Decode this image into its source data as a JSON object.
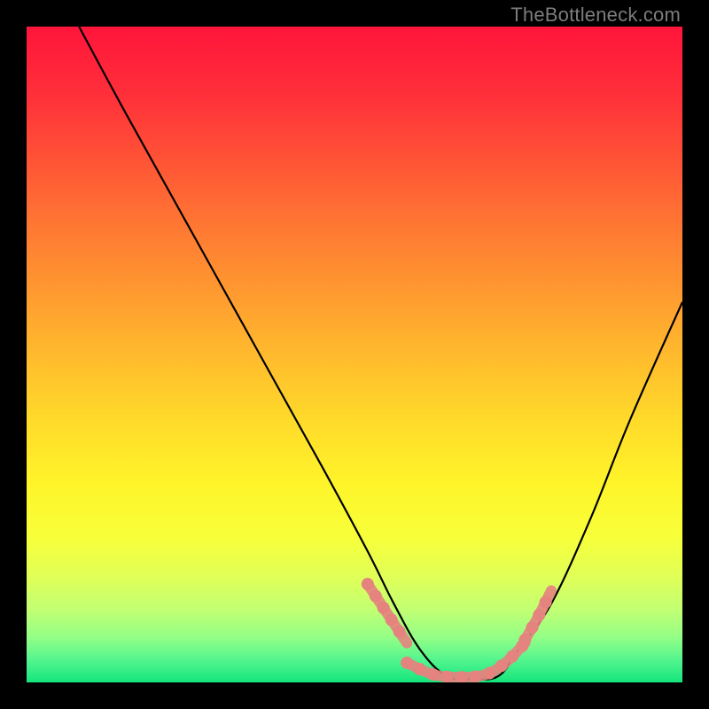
{
  "watermark": "TheBottleneck.com",
  "gradient": {
    "stops": [
      {
        "offset": 0.0,
        "color": "#ff153b"
      },
      {
        "offset": 0.1,
        "color": "#ff2e3a"
      },
      {
        "offset": 0.2,
        "color": "#ff5236"
      },
      {
        "offset": 0.3,
        "color": "#ff7633"
      },
      {
        "offset": 0.4,
        "color": "#ff9830"
      },
      {
        "offset": 0.5,
        "color": "#ffba2d"
      },
      {
        "offset": 0.6,
        "color": "#ffda2a"
      },
      {
        "offset": 0.7,
        "color": "#fff52a"
      },
      {
        "offset": 0.78,
        "color": "#f7ff3a"
      },
      {
        "offset": 0.84,
        "color": "#e0ff58"
      },
      {
        "offset": 0.89,
        "color": "#c1ff73"
      },
      {
        "offset": 0.93,
        "color": "#95ff86"
      },
      {
        "offset": 0.965,
        "color": "#55f58e"
      },
      {
        "offset": 1.0,
        "color": "#14e57d"
      }
    ]
  },
  "chart_data": {
    "type": "line",
    "title": "",
    "xlabel": "",
    "ylabel": "",
    "xlim": [
      0,
      100
    ],
    "ylim": [
      0,
      100
    ],
    "series": [
      {
        "name": "bottleneck-curve",
        "x": [
          8,
          15,
          25,
          35,
          45,
          52,
          56,
          60,
          64,
          68,
          72,
          75,
          80,
          86,
          92,
          100
        ],
        "y": [
          100,
          87,
          69,
          51,
          33,
          20,
          12,
          5,
          1,
          0.5,
          1,
          5,
          12,
          25,
          40,
          58
        ]
      }
    ],
    "highlight_band": {
      "color": "#e5837f",
      "segments": [
        {
          "x": [
            52,
            56,
            58
          ],
          "y": [
            15,
            9,
            6
          ]
        },
        {
          "x": [
            58,
            62,
            66,
            70,
            73,
            76
          ],
          "y": [
            3,
            1.2,
            0.8,
            1.2,
            3,
            6
          ]
        },
        {
          "x": [
            76,
            78,
            80
          ],
          "y": [
            6.5,
            10,
            14
          ]
        }
      ]
    }
  }
}
